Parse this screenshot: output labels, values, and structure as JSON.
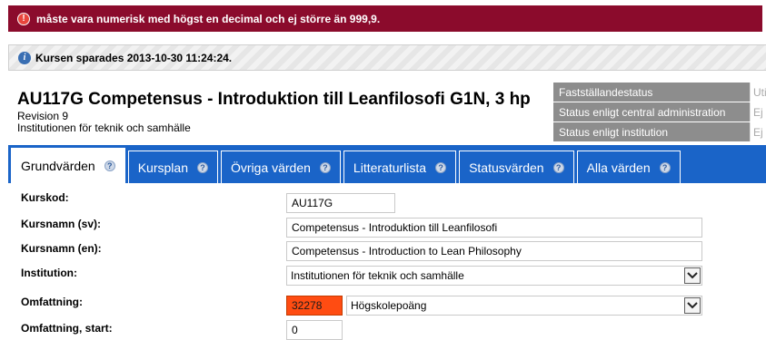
{
  "error": {
    "message": "måste vara numerisk med högst en decimal och ej större än 999,9."
  },
  "info": {
    "message": "Kursen sparades 2013-10-30 11:24:24."
  },
  "course": {
    "title": "AU117G Competensus - Introduktion till Leanfilosofi G1N, 3 hp",
    "revision": "Revision 9",
    "department": "Institutionen för teknik och samhälle"
  },
  "status": [
    {
      "label": "Fastställandestatus",
      "value": "Uti"
    },
    {
      "label": "Status enligt central administration",
      "value": "Ej"
    },
    {
      "label": "Status enligt institution",
      "value": "Ej"
    }
  ],
  "tabs": [
    {
      "label": "Grundvärden",
      "active": true
    },
    {
      "label": "Kursplan"
    },
    {
      "label": "Övriga värden"
    },
    {
      "label": "Litteraturlista"
    },
    {
      "label": "Statusvärden"
    },
    {
      "label": "Alla värden"
    }
  ],
  "form": {
    "kurskod": {
      "label": "Kurskod:",
      "value": "AU117G"
    },
    "kursnamn_sv": {
      "label": "Kursnamn (sv):",
      "value": "Competensus - Introduktion till Leanfilosofi"
    },
    "kursnamn_en": {
      "label": "Kursnamn (en):",
      "value": "Competensus - Introduction to Lean Philosophy"
    },
    "institution": {
      "label": "Institution:",
      "value": "Institutionen för teknik och samhälle"
    },
    "omfattning": {
      "label": "Omfattning:",
      "value": "32278",
      "unit": "Högskolepoäng"
    },
    "omfattning_start": {
      "label": "Omfattning, start:",
      "value": "0"
    }
  },
  "colors": {
    "error_bg": "#8b0b2c",
    "tab_bg": "#1a64c8",
    "status_label_bg": "#8d8d8d",
    "field_error": "#ff4c12"
  }
}
